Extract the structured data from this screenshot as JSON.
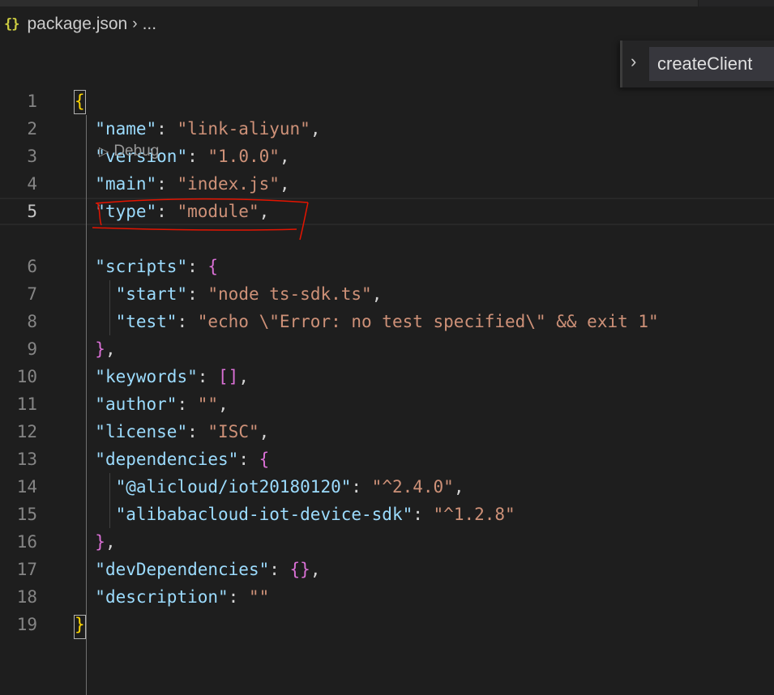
{
  "breadcrumb": {
    "icon": "json-braces-icon",
    "icon_text": "{}",
    "file": "package.json",
    "more": "..."
  },
  "sticky_scroll": {
    "label": "createClient"
  },
  "codelens": {
    "label": "Debug"
  },
  "colors": {
    "background": "#1e1e1e",
    "key": "#9cdcfe",
    "string": "#ce9178",
    "bracket_level1": "#ffd700",
    "bracket_level2": "#da70d6",
    "annotation": "#e51400"
  },
  "lines": [
    {
      "n": "1",
      "t": [
        [
          "b1",
          "{"
        ]
      ]
    },
    {
      "n": "2",
      "t": [
        [
          "p",
          "  "
        ],
        [
          "k",
          "\"name\""
        ],
        [
          "p",
          ": "
        ],
        [
          "s",
          "\"link-aliyun\""
        ],
        [
          "p",
          ","
        ]
      ]
    },
    {
      "n": "3",
      "t": [
        [
          "p",
          "  "
        ],
        [
          "k",
          "\"version\""
        ],
        [
          "p",
          ": "
        ],
        [
          "s",
          "\"1.0.0\""
        ],
        [
          "p",
          ","
        ]
      ]
    },
    {
      "n": "4",
      "t": [
        [
          "p",
          "  "
        ],
        [
          "k",
          "\"main\""
        ],
        [
          "p",
          ": "
        ],
        [
          "s",
          "\"index.js\""
        ],
        [
          "p",
          ","
        ]
      ]
    },
    {
      "n": "5",
      "t": [
        [
          "p",
          "  "
        ],
        [
          "k",
          "\"type\""
        ],
        [
          "p",
          ": "
        ],
        [
          "s",
          "\"module\""
        ],
        [
          "p",
          ","
        ]
      ],
      "active": true
    },
    {
      "n": "6",
      "t": [
        [
          "p",
          "  "
        ],
        [
          "k",
          "\"scripts\""
        ],
        [
          "p",
          ": "
        ],
        [
          "b2",
          "{"
        ]
      ]
    },
    {
      "n": "7",
      "t": [
        [
          "p",
          "    "
        ],
        [
          "k",
          "\"start\""
        ],
        [
          "p",
          ": "
        ],
        [
          "s",
          "\"node ts-sdk.ts\""
        ],
        [
          "p",
          ","
        ]
      ]
    },
    {
      "n": "8",
      "t": [
        [
          "p",
          "    "
        ],
        [
          "k",
          "\"test\""
        ],
        [
          "p",
          ": "
        ],
        [
          "s",
          "\"echo \\\"Error: no test specified\\\" && exit 1\""
        ]
      ]
    },
    {
      "n": "9",
      "t": [
        [
          "p",
          "  "
        ],
        [
          "b2",
          "}"
        ],
        [
          "p",
          ","
        ]
      ]
    },
    {
      "n": "10",
      "t": [
        [
          "p",
          "  "
        ],
        [
          "k",
          "\"keywords\""
        ],
        [
          "p",
          ": "
        ],
        [
          "b2",
          "[]"
        ],
        [
          "p",
          ","
        ]
      ]
    },
    {
      "n": "11",
      "t": [
        [
          "p",
          "  "
        ],
        [
          "k",
          "\"author\""
        ],
        [
          "p",
          ": "
        ],
        [
          "s",
          "\"\""
        ],
        [
          "p",
          ","
        ]
      ]
    },
    {
      "n": "12",
      "t": [
        [
          "p",
          "  "
        ],
        [
          "k",
          "\"license\""
        ],
        [
          "p",
          ": "
        ],
        [
          "s",
          "\"ISC\""
        ],
        [
          "p",
          ","
        ]
      ]
    },
    {
      "n": "13",
      "t": [
        [
          "p",
          "  "
        ],
        [
          "k",
          "\"dependencies\""
        ],
        [
          "p",
          ": "
        ],
        [
          "b2",
          "{"
        ]
      ]
    },
    {
      "n": "14",
      "t": [
        [
          "p",
          "    "
        ],
        [
          "k",
          "\"@alicloud/iot20180120\""
        ],
        [
          "p",
          ": "
        ],
        [
          "s",
          "\"^2.4.0\""
        ],
        [
          "p",
          ","
        ]
      ]
    },
    {
      "n": "15",
      "t": [
        [
          "p",
          "    "
        ],
        [
          "k",
          "\"alibabacloud-iot-device-sdk\""
        ],
        [
          "p",
          ": "
        ],
        [
          "s",
          "\"^1.2.8\""
        ]
      ]
    },
    {
      "n": "16",
      "t": [
        [
          "p",
          "  "
        ],
        [
          "b2",
          "}"
        ],
        [
          "p",
          ","
        ]
      ]
    },
    {
      "n": "17",
      "t": [
        [
          "p",
          "  "
        ],
        [
          "k",
          "\"devDependencies\""
        ],
        [
          "p",
          ": "
        ],
        [
          "b2",
          "{}"
        ],
        [
          "p",
          ","
        ]
      ]
    },
    {
      "n": "18",
      "t": [
        [
          "p",
          "  "
        ],
        [
          "k",
          "\"description\""
        ],
        [
          "p",
          ": "
        ],
        [
          "s",
          "\"\""
        ]
      ]
    },
    {
      "n": "19",
      "t": [
        [
          "b1",
          "}"
        ]
      ]
    }
  ]
}
